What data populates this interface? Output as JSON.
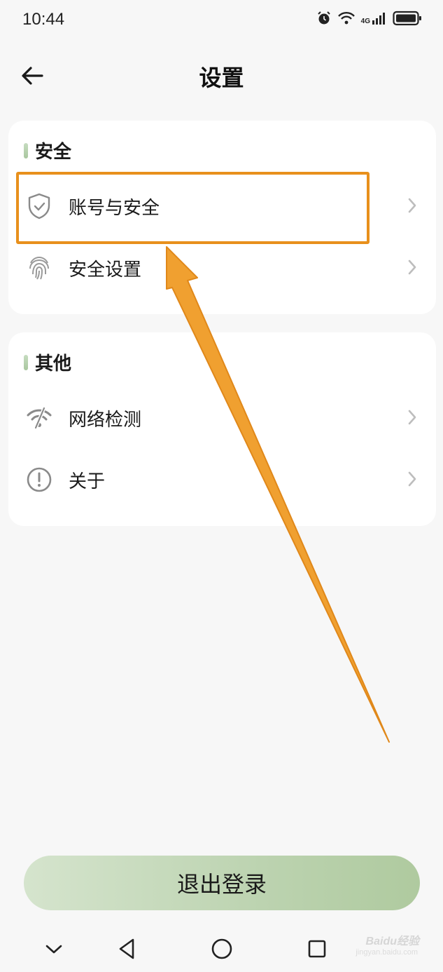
{
  "status_bar": {
    "time": "10:44",
    "network_label": "4G",
    "icons": [
      "alarm-icon",
      "wifi-icon",
      "cellular-signal-icon",
      "battery-icon"
    ]
  },
  "header": {
    "title": "设置",
    "back_icon": "arrow-left-icon"
  },
  "sections": {
    "security": {
      "title": "安全",
      "items": [
        {
          "label": "账号与安全",
          "icon": "shield-check-icon"
        },
        {
          "label": "安全设置",
          "icon": "fingerprint-icon"
        }
      ]
    },
    "other": {
      "title": "其他",
      "items": [
        {
          "label": "网络检测",
          "icon": "wifi-off-icon"
        },
        {
          "label": "关于",
          "icon": "info-circle-icon"
        }
      ]
    }
  },
  "annotation": {
    "highlight_color": "#e8901c",
    "arrow_color": "#f0a030"
  },
  "logout": {
    "label": "退出登录"
  },
  "nav_bar": {
    "icons": [
      "chevron-down-icon",
      "back-triangle-icon",
      "home-circle-icon",
      "recents-square-icon"
    ]
  },
  "watermark": {
    "text": "Baidu经验",
    "sub": "jingyan.baidu.com"
  },
  "colors": {
    "accent_green": "#afca9f",
    "background": "#f7f7f7"
  }
}
